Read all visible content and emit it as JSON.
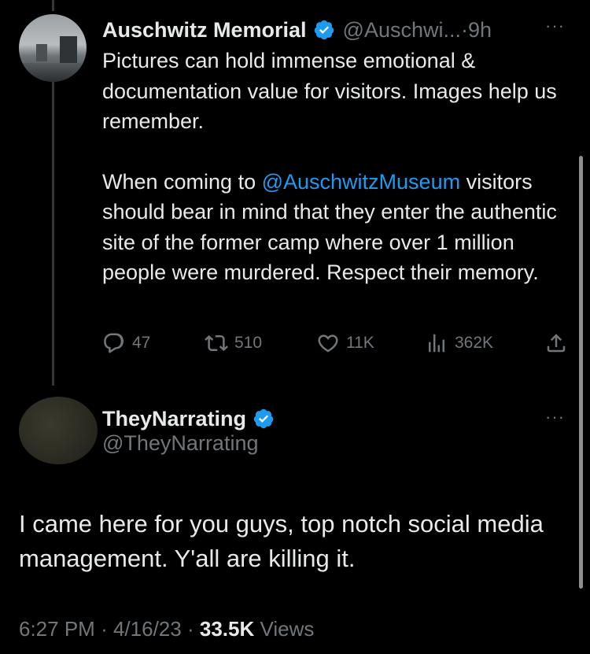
{
  "original_tweet": {
    "author_name": "Auschwitz Memorial",
    "handle": "@Auschwi...",
    "separator": "·",
    "time": "9h",
    "more": "···",
    "paragraph1": "Pictures can hold immense emotional & documentation value for visitors. Images help us remember.",
    "paragraph2_prefix": "When coming to ",
    "mention": "@AuschwitzMuseum",
    "paragraph2_suffix": " visitors should bear in mind that they enter the authentic site of the former camp where over 1 million people were murdered. Respect their memory.",
    "actions": {
      "replies": "47",
      "retweets": "510",
      "likes": "11K",
      "views": "362K"
    }
  },
  "reply_tweet": {
    "author_name": "TheyNarrating",
    "handle": "@TheyNarrating",
    "more": "···",
    "text": "I came here for you guys, top notch social media management. Y'all are killing it.",
    "time": "6:27 PM",
    "date": "4/16/23",
    "separator": "·",
    "views_count": "33.5K",
    "views_label": "Views"
  },
  "colors": {
    "background": "#000000",
    "text_primary": "#e7e9ea",
    "text_secondary": "#71767b",
    "accent": "#1d9bf0",
    "verified_badge": "#1d9bf0"
  },
  "icons": [
    "reply-icon",
    "retweet-icon",
    "like-icon",
    "views-icon",
    "share-icon",
    "verified-badge-icon",
    "more-icon"
  ]
}
